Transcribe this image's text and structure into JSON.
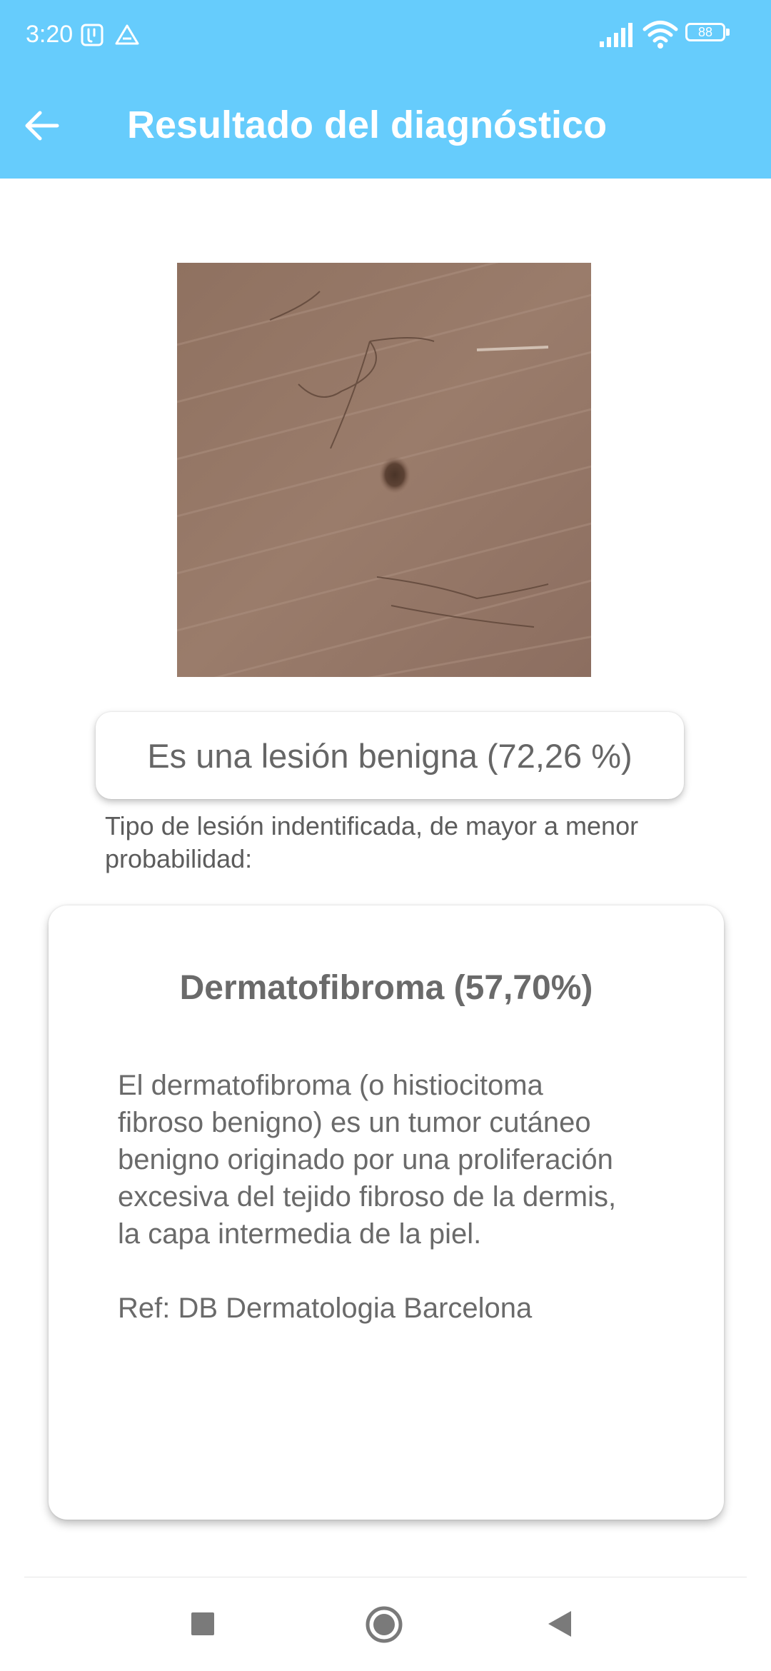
{
  "status_bar": {
    "time": "3:20",
    "battery_level": "88",
    "icons": [
      "notification-app-icon",
      "drive-icon",
      "signal-icon",
      "wifi-icon",
      "battery-icon"
    ]
  },
  "app_bar": {
    "title": "Resultado del diagnóstico",
    "back_icon": "arrow-back-icon"
  },
  "result": {
    "summary": "Es una lesión benigna (72,26 %)",
    "types_label": "Tipo de lesión indentificada, de mayor a menor probabilidad:"
  },
  "card": {
    "title": "Dermatofibroma (57,70%)",
    "description": "El dermatofibroma (o histiocitoma fibroso benigno) es un tumor cutáneo benigno originado por una proliferación excesiva del tejido fibroso de la dermis, la capa intermedia de la piel.",
    "reference": "Ref: DB Dermatologia Barcelona"
  },
  "nav_bar": {
    "buttons": [
      "recents-square-icon",
      "home-circle-icon",
      "back-triangle-icon"
    ]
  },
  "colors": {
    "app_bar": "#66ccfc",
    "text_secondary": "#6a6a6a",
    "background": "#ffffff"
  }
}
